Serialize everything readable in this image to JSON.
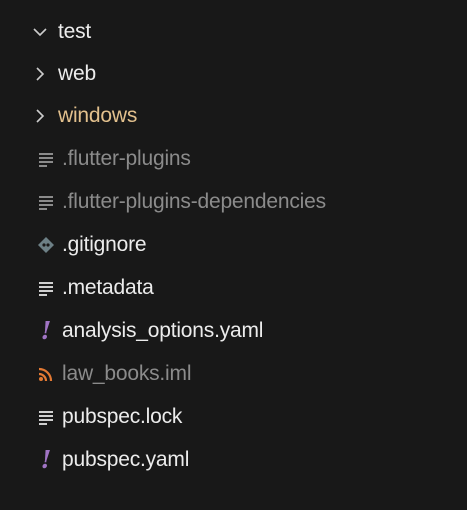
{
  "explorer": {
    "items": [
      {
        "label": "test",
        "icon": "chevron-down-icon",
        "type": "folder-open"
      },
      {
        "label": "web",
        "icon": "chevron-right-icon",
        "type": "folder"
      },
      {
        "label": "windows",
        "icon": "chevron-right-icon",
        "type": "folder"
      },
      {
        "label": ".flutter-plugins",
        "icon": "text-lines-icon",
        "type": "file"
      },
      {
        "label": ".flutter-plugins-dependencies",
        "icon": "text-lines-icon",
        "type": "file"
      },
      {
        "label": ".gitignore",
        "icon": "git-diamond-icon",
        "type": "file"
      },
      {
        "label": ".metadata",
        "icon": "text-lines-icon",
        "type": "file"
      },
      {
        "label": "analysis_options.yaml",
        "icon": "yaml-exclamation-icon",
        "type": "file"
      },
      {
        "label": "law_books.iml",
        "icon": "rss-icon",
        "type": "file"
      },
      {
        "label": "pubspec.lock",
        "icon": "text-lines-icon",
        "type": "file"
      },
      {
        "label": "pubspec.yaml",
        "icon": "yaml-exclamation-icon",
        "type": "file"
      }
    ]
  },
  "colors": {
    "background": "#181818",
    "folder_name": "#e2c08d",
    "ignored_text": "#8b8b8b",
    "normal_text": "#d7d7d7",
    "yaml_icon": "#a074c4",
    "rss_icon": "#e37933",
    "git_icon": "#6d8086"
  }
}
